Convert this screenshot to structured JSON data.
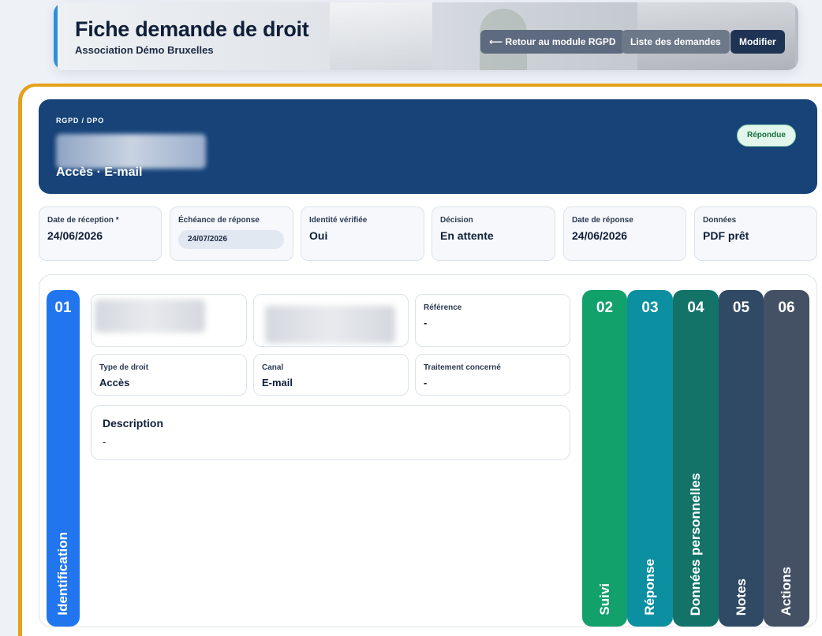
{
  "header": {
    "title": "Fiche demande de droit",
    "subtitle": "Association Démo Bruxelles",
    "buttons": {
      "back": "⟵ Retour au module RGPD",
      "list": "Liste des demandes",
      "edit": "Modifier"
    }
  },
  "banner": {
    "tag": "RGPD / DPO",
    "type_line": "Accès · E-mail",
    "status": "Répondue",
    "status_color": "#17703f"
  },
  "metrics": [
    {
      "label": "Date de réception *",
      "value": "24/06/2026"
    },
    {
      "label": "Échéance de réponse",
      "value": "24/07/2026"
    },
    {
      "label": "Identité vérifiée",
      "value": "Oui"
    },
    {
      "label": "Décision",
      "value": "En attente"
    },
    {
      "label": "Date de réponse",
      "value": "24/06/2026"
    },
    {
      "label": "Données",
      "value": "PDF prêt"
    }
  ],
  "tabs": [
    {
      "num": "01",
      "label": "Identification",
      "color": "#2176f0"
    },
    {
      "num": "02",
      "label": "Suivi",
      "color": "#12a06b"
    },
    {
      "num": "03",
      "label": "Réponse",
      "color": "#0c8fa0"
    },
    {
      "num": "04",
      "label": "Données personnelles",
      "color": "#147368"
    },
    {
      "num": "05",
      "label": "Notes",
      "color": "#304964"
    },
    {
      "num": "06",
      "label": "Actions",
      "color": "#445164"
    }
  ],
  "identification": {
    "fields": [
      {
        "label": "Référence",
        "value": "-"
      },
      {
        "label": "Type de droit",
        "value": "Accès"
      },
      {
        "label": "Canal",
        "value": "E-mail"
      },
      {
        "label": "Traitement concerné",
        "value": "-"
      }
    ],
    "description": {
      "title": "Description",
      "text": "-"
    }
  }
}
